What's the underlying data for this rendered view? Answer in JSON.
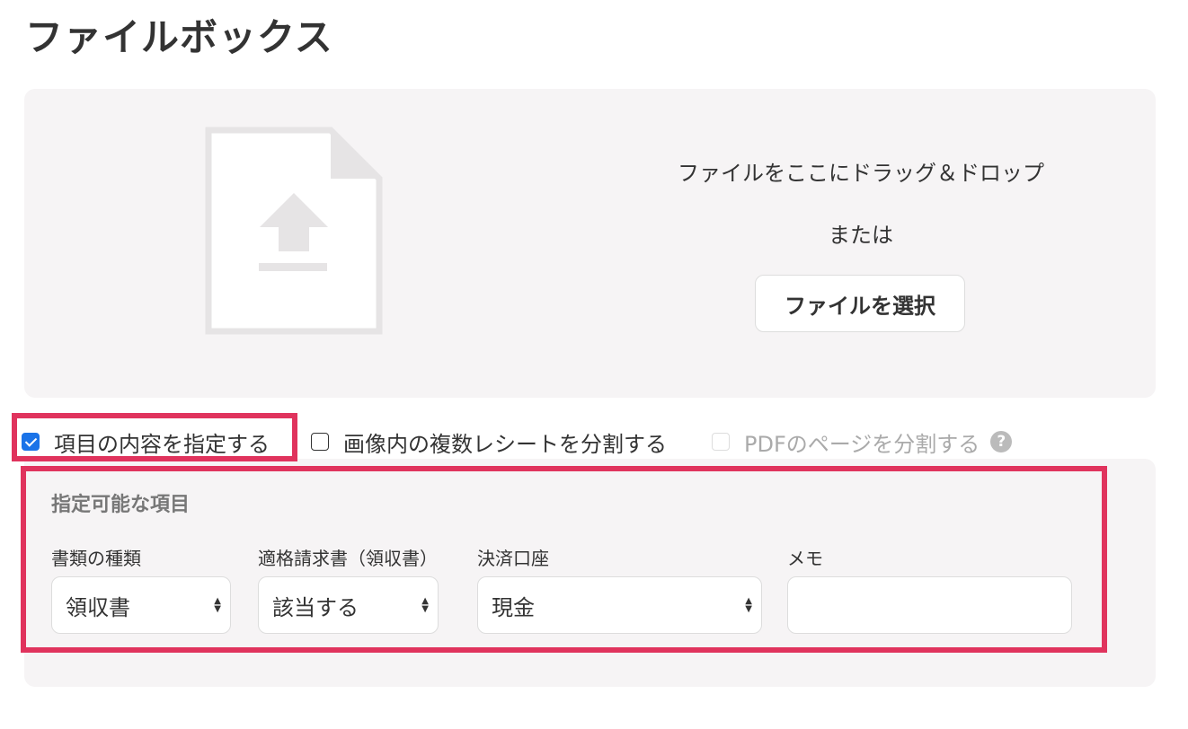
{
  "page": {
    "title": "ファイルボックス"
  },
  "dropzone": {
    "instruction": "ファイルをここにドラッグ＆ドロップ",
    "or": "または",
    "select_button": "ファイルを選択",
    "icon": "file-upload-icon"
  },
  "options": {
    "specify_items": {
      "label": "項目の内容を指定する",
      "checked": true
    },
    "split_receipts": {
      "label": "画像内の複数レシートを分割する",
      "checked": false
    },
    "split_pdf": {
      "label": "PDFのページを分割する",
      "checked": false,
      "disabled": true,
      "help_icon": "?"
    }
  },
  "specifiable": {
    "title": "指定可能な項目",
    "fields": [
      {
        "label": "書類の種類",
        "value": "領収書"
      },
      {
        "label": "適格請求書（領収書）",
        "value": "該当する"
      },
      {
        "label": "決済口座",
        "value": "現金"
      },
      {
        "label": "メモ",
        "value": ""
      }
    ]
  },
  "colors": {
    "highlight": "#e0335d",
    "panel": "#f6f4f5",
    "checkbox": "#1a73e8"
  }
}
